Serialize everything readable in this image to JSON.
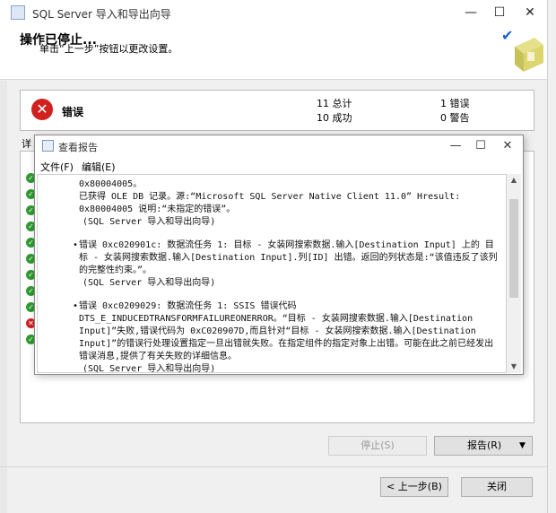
{
  "window": {
    "title": "SQL Server 导入和导出向导",
    "min": "—",
    "max": "☐",
    "close": "✕"
  },
  "header": {
    "title": "操作已停止...",
    "subtitle": "单击“上一步”按钮以更改设置。"
  },
  "status": {
    "label": "错误",
    "total": "11 总计",
    "success": "10 成功",
    "errors": "1 错误",
    "warnings": "0 警告"
  },
  "details_label": "详",
  "buttons": {
    "stop": "停止(S)",
    "report": "报告(R)",
    "back": "< 上一步(B)",
    "close": "关闭"
  },
  "dialog": {
    "title": "查看报告",
    "menu": [
      "文件(F)",
      "编辑(E)"
    ],
    "min": "—",
    "max": "☐",
    "close": "✕",
    "up_arrow": "▲",
    "down_arrow": "▼",
    "lines": [
      "0x80004005。",
      "已获得 OLE DB 记录。源:“Microsoft SQL Server Native Client 11.0” Hresult: 0x80004005 说明:“未指定的错误”。",
      "(SQL Server 导入和导出向导)",
      "错误 0xc020901c: 数据流任务 1: 目标 - 女装网搜索数据.输入[Destination Input] 上的 目标 - 女装网搜索数据.输入[Destination Input].列[ID] 出错。返回的列状态是:“该值违反了该列的完整性约束。”。",
      "(SQL Server 导入和导出向导)",
      "错误 0xc0209029: 数据流任务 1: SSIS 错误代码 DTS_E_INDUCEDTRANSFORMFAILUREONERROR。“目标 - 女装网搜索数据.输入[Destination Input]”失败,错误代码为 0xC020907D,而且针对“目标 - 女装网搜索数据.输入[Destination Input]”的错误行处理设置指定一旦出错就失败。在指定组件的指定对象上出错。可能在此之前已经发出错误消息,提供了有关失败的详细信息。",
      "(SQL Server 导入和导出向导)"
    ]
  },
  "colors": {
    "error": "#d02020",
    "success": "#2e9a2e",
    "accent": "#1a62c4"
  }
}
